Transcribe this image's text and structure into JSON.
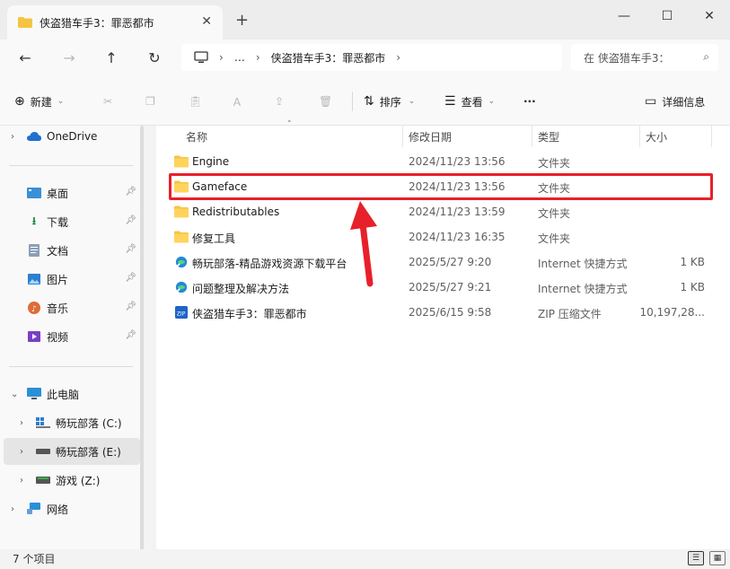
{
  "window": {
    "tab_title": "侠盗猎车手3：罪恶都市",
    "tab_close": "✕",
    "tab_add": "+",
    "minimize": "—",
    "maximize": "☐",
    "close": "✕"
  },
  "nav": {
    "back": "←",
    "forward": "→",
    "up": "↑",
    "refresh": "↻",
    "more": "…",
    "breadcrumb": "侠盗猎车手3：罪恶都市",
    "search_placeholder": "在 侠盗猎车手3：",
    "search_icon": "⌕"
  },
  "toolbar": {
    "new_label": "新建",
    "sort_label": "排序",
    "view_label": "查看",
    "more_label": "···",
    "details_label": "详细信息"
  },
  "sidebar": {
    "onedrive": "OneDrive",
    "quick": [
      {
        "label": "桌面"
      },
      {
        "label": "下载"
      },
      {
        "label": "文档"
      },
      {
        "label": "图片"
      },
      {
        "label": "音乐"
      },
      {
        "label": "视频"
      }
    ],
    "this_pc": "此电脑",
    "drives": [
      {
        "label": "畅玩部落 (C:)"
      },
      {
        "label": "畅玩部落 (E:)"
      },
      {
        "label": "游戏 (Z:)"
      }
    ],
    "network": "网络"
  },
  "columns": {
    "name": "名称",
    "date": "修改日期",
    "type": "类型",
    "size": "大小"
  },
  "files": [
    {
      "name": "Engine",
      "date": "2024/11/23 13:56",
      "type": "文件夹",
      "size": "",
      "icon": "folder-icon"
    },
    {
      "name": "Gameface",
      "date": "2024/11/23 13:56",
      "type": "文件夹",
      "size": "",
      "icon": "folder-icon"
    },
    {
      "name": "Redistributables",
      "date": "2024/11/23 13:59",
      "type": "文件夹",
      "size": "",
      "icon": "folder-icon"
    },
    {
      "name": "修复工具",
      "date": "2024/11/23 16:35",
      "type": "文件夹",
      "size": "",
      "icon": "folder-icon"
    },
    {
      "name": "畅玩部落-精品游戏资源下载平台",
      "date": "2025/5/27 9:20",
      "type": "Internet 快捷方式",
      "size": "1 KB",
      "icon": "internet-shortcut-icon"
    },
    {
      "name": "问题整理及解决方法",
      "date": "2025/5/27 9:21",
      "type": "Internet 快捷方式",
      "size": "1 KB",
      "icon": "internet-shortcut-icon"
    },
    {
      "name": "侠盗猎车手3：罪恶都市",
      "date": "2025/6/15 9:58",
      "type": "ZIP 压缩文件",
      "size": "10,197,28...",
      "icon": "zip-file-icon"
    }
  ],
  "status": {
    "count": "7 个项目"
  },
  "colors": {
    "highlight": "#e8202a",
    "folder": "#f5c443",
    "accent": "#0067c0"
  }
}
